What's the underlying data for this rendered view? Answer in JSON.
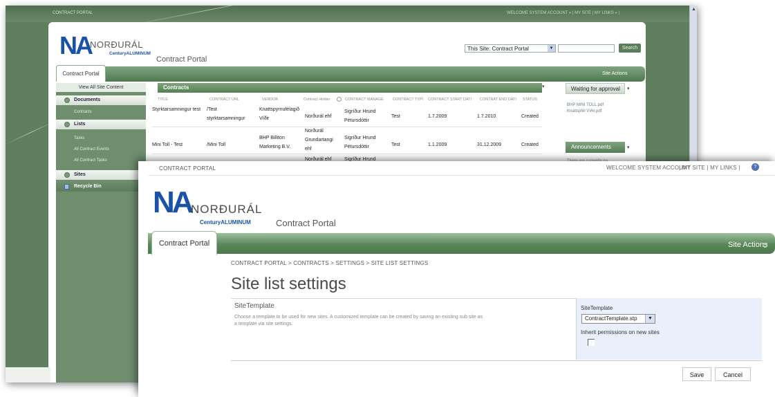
{
  "colors": {
    "brand_blue": "#1a52a8",
    "nav_green": "#5a875a",
    "panel_blue": "#e9f0fb"
  },
  "back_window": {
    "top_label": "CONTRACT PORTAL",
    "welcome": "WELCOME SYSTEM ACCOUNT » | MY SITE | MY LINKS » |",
    "logo_text": "NORÐURÁL",
    "logo_sub": "CenturyALUMINUM",
    "page_title": "Contract Portal",
    "search_scope": "This Site: Contract Portal",
    "search_button": "Search",
    "tab": "Contract Portal",
    "site_actions": "Site Actions",
    "left_nav": {
      "view_all": "View All Site Content",
      "sections": [
        {
          "label": "Documents",
          "items": [
            "Contracts"
          ]
        },
        {
          "label": "Lists",
          "items": [
            "Tasks",
            "All Contract Events",
            "All Contract Tasks"
          ]
        },
        {
          "label": "Sites",
          "items": []
        },
        {
          "label": "Recycle Bin",
          "items": []
        }
      ]
    },
    "contracts": {
      "title": "Contracts",
      "headers": [
        "TITLE",
        "CONTRACT URL",
        "VENDOR",
        "Contract Holder",
        "CONTRACT MANAGE",
        "CONTRACT TYPI",
        "CONTRACT START DATI",
        "CONTRAT END DATI",
        "STATUS"
      ],
      "rows": [
        [
          "Styrktarsamningur test",
          "/Test styrktarsamningur",
          "Knattspyrnufélagið Víðir",
          "Norðurál ehf",
          "Sigríður Hrund Pétursdóttir",
          "Test",
          "1.7.2009",
          "1.7.2010",
          "Created"
        ],
        [
          "Mini Toll - Test",
          "/Mini Toll",
          "BHP Billiton Marketing B.V.",
          "Norðurál Grundartangi ehf",
          "Sigríður Hrund Pétursdóttir",
          "Test",
          "1.1.2009",
          "31.12.2009",
          "Created"
        ],
        [
          "",
          "",
          "",
          "Norðurál ehf",
          "Sigríður Hrund",
          "",
          "",
          "",
          ""
        ]
      ]
    },
    "waiting": {
      "title": "Waiting for approval",
      "items": [
        "BHP MINI TOLL.pdf",
        "Knattspfél Víðir.pdf"
      ]
    },
    "announcements": {
      "title": "Announcements",
      "text": "There are currently no"
    }
  },
  "front_window": {
    "top_label": "CONTRACT PORTAL",
    "welcome": "WELCOME SYSTEM ACCOUNT",
    "my_links": "| MY SITE | MY LINKS |",
    "help_glyph": "?",
    "logo_text": "NORÐURÁL",
    "logo_sub": "CenturyALUMINUM",
    "page_title": "Contract Portal",
    "tab": "Contract Portal",
    "site_actions": "Site Actions",
    "breadcrumb": "CONTRACT PORTAL > CONTRACTS > SETTINGS > SITE LIST SETTINGS",
    "heading": "Site list settings",
    "section": {
      "title": "SiteTemplate",
      "description": "Choose a template to be used for new sites. A customized template can be created by saving an existing sub site as a template via site settings.",
      "field_label": "SiteTemplate",
      "selected": "ContractTemplate.stp",
      "inherit_label": "Inherit permissions on new sites",
      "inherit_checked": false
    },
    "buttons": {
      "save": "Save",
      "cancel": "Cancel"
    }
  }
}
